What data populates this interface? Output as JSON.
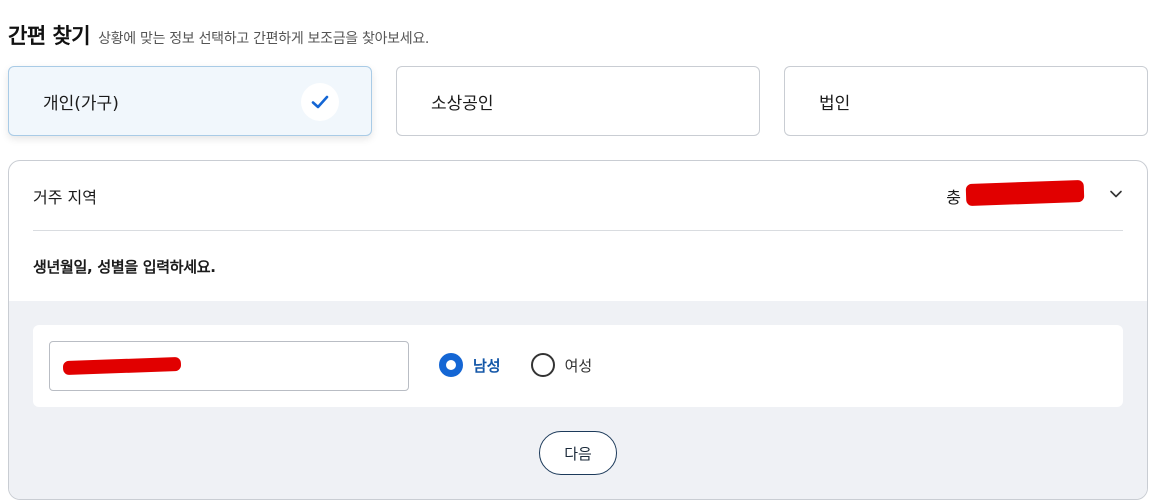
{
  "header": {
    "title": "간편 찾기",
    "subtitle": "상황에 맞는 정보 선택하고 간편하게 보조금을 찾아보세요."
  },
  "user_types": [
    {
      "label": "개인(가구)",
      "selected": true
    },
    {
      "label": "소상공인",
      "selected": false
    },
    {
      "label": "법인",
      "selected": false
    }
  ],
  "region": {
    "label": "거주 지역",
    "value": "충"
  },
  "form": {
    "instruction": "생년월일, 성별을 입력하세요.",
    "birthdate_value": "",
    "gender_options": [
      {
        "label": "남성",
        "checked": true
      },
      {
        "label": "여성",
        "checked": false
      }
    ],
    "next_label": "다음"
  },
  "colors": {
    "accent": "#1466d4",
    "selected_card_bg": "#f1f7fc",
    "grey_area": "#eff1f5",
    "redaction": "#e10000"
  },
  "icons": {
    "check": "check-icon",
    "region_dropdown": "chevron-down-icon"
  }
}
